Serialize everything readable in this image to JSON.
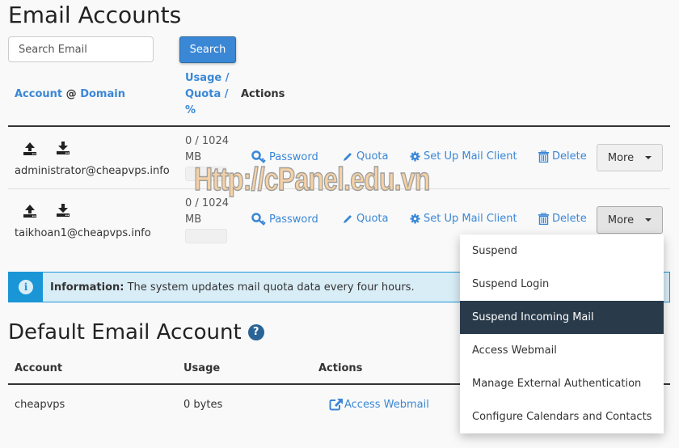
{
  "page": {
    "title": "Email Accounts"
  },
  "search": {
    "placeholder": "Search Email",
    "value": "",
    "button": "Search"
  },
  "table": {
    "headers": {
      "account": "Account",
      "at": "@",
      "domain": "Domain",
      "usage_line1": "Usage /",
      "usage_line2": "Quota /",
      "usage_line3": "%",
      "actions": "Actions"
    },
    "rows": [
      {
        "email": "administrator@cheapvps.info",
        "usage_line1": "0 / 1024",
        "usage_line2": "MB",
        "usage_percent": 0
      },
      {
        "email": "taikhoan1@cheapvps.info",
        "usage_line1": "0 / 1024",
        "usage_line2": "MB",
        "usage_percent": 0
      }
    ],
    "actions": {
      "password": "Password",
      "quota": "Quota",
      "setup": "Set Up Mail Client",
      "delete": "Delete",
      "more": "More"
    }
  },
  "watermark": "Http://cPanel.edu.vn",
  "info": {
    "label": "Information:",
    "text": "The system updates mail quota data every four hours."
  },
  "default_account": {
    "title": "Default Email Account",
    "headers": {
      "account": "Account",
      "usage": "Usage",
      "actions": "Actions"
    },
    "row": {
      "account": "cheapvps",
      "usage": "0 bytes",
      "action": "Access Webmail"
    }
  },
  "more_menu": {
    "items": [
      "Suspend",
      "Suspend Login",
      "Suspend Incoming Mail",
      "Access Webmail",
      "Manage External Authentication",
      "Configure Calendars and Contacts"
    ],
    "highlighted": "Suspend Incoming Mail"
  },
  "colors": {
    "link": "#3a87d6",
    "primary": "#3a87d6",
    "info_accent": "#1a96d6",
    "menu_highlight": "#293a4a"
  }
}
